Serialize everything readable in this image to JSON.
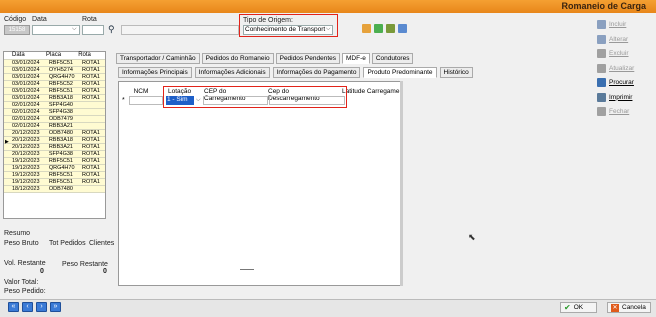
{
  "title": "Romaneio de Carga",
  "header": {
    "codigo_label": "Código",
    "codigo_value": "15158",
    "data_label": "Data",
    "rota_label": "Rota",
    "tipo_origem_label": "Tipo de Origem:",
    "tipo_origem_value": "Conhecimento de Transport"
  },
  "list": {
    "columns": [
      "Data",
      "Placa",
      "Rota"
    ],
    "rows": [
      [
        "03/01/2024",
        "RBF5C51",
        "ROTA1"
      ],
      [
        "03/01/2024",
        "OYH5274",
        "ROTA1"
      ],
      [
        "03/01/2024",
        "QRG4H70",
        "ROTA1"
      ],
      [
        "03/01/2024",
        "RBF5C52",
        "ROTA1"
      ],
      [
        "03/01/2024",
        "RBF5C51",
        "ROTA1"
      ],
      [
        "03/01/2024",
        "RBB3A18",
        "ROTA1"
      ],
      [
        "02/01/2024",
        "SFP4G40",
        ""
      ],
      [
        "02/01/2024",
        "SFP4G38",
        ""
      ],
      [
        "02/01/2024",
        "ODB7479",
        ""
      ],
      [
        "02/01/2024",
        "RBB3A21",
        ""
      ],
      [
        "20/12/2023",
        "ODB7480",
        "ROTA1"
      ],
      [
        "20/12/2023",
        "RBB3A18",
        "ROTA1"
      ],
      [
        "20/12/2023",
        "RBB3A21",
        "ROTA1"
      ],
      [
        "20/12/2023",
        "SFP4G38",
        "ROTA1"
      ],
      [
        "19/12/2023",
        "RBF5C51",
        "ROTA1"
      ],
      [
        "19/12/2023",
        "QRG4H70",
        "ROTA1"
      ],
      [
        "19/12/2023",
        "RBF5C51",
        "ROTA1"
      ],
      [
        "19/12/2023",
        "RBF5C51",
        "ROTA1"
      ],
      [
        "18/12/2023",
        "ODB7480",
        ""
      ]
    ]
  },
  "summary": {
    "resumo": "Resumo",
    "peso_bruto": "Peso Bruto",
    "tot_pedidos": "Tot Pedidos",
    "clientes": "Clientes",
    "vol_restante": "Vol. Restante",
    "vol_restante_value": "0",
    "peso_restante": "Peso Restante",
    "peso_restante_value": "0",
    "valor_total": "Valor Total:",
    "peso_pedido": "Peso Pedido:"
  },
  "tabs_row1": [
    "Transportador / Caminhão",
    "Pedidos do Romaneio",
    "Pedidos Pendentes",
    "MDF-e",
    "Condutores"
  ],
  "tabs_row2": [
    "Informações Principais",
    "Informações Adicionais",
    "Informações do Pagamento",
    "Produto Predominante",
    "Histórico"
  ],
  "grid": {
    "columns": [
      "NCM",
      "Lotação",
      "CEP do Carregamento",
      "Cep do Descarregamento",
      "Latitude Carregame"
    ],
    "row_marker": "*",
    "lotacao_value": "1 - Sim"
  },
  "side_buttons": [
    {
      "label": "Incluir",
      "enabled": false,
      "color": "#8aa0c0"
    },
    {
      "label": "Alterar",
      "enabled": false,
      "color": "#8aa0c0"
    },
    {
      "label": "Excluir",
      "enabled": false,
      "color": "#a0a0a0"
    },
    {
      "label": "Atualizar",
      "enabled": false,
      "color": "#a0a0a0"
    },
    {
      "label": "Procurar",
      "enabled": true,
      "color": "#3a6fb0"
    },
    {
      "label": "Imprimir",
      "enabled": true,
      "color": "#5a7a9a"
    },
    {
      "label": "Fechar",
      "enabled": false,
      "color": "#a0a0a0"
    }
  ],
  "footer": {
    "ok_label": "OK",
    "cancel_label": "Cancela",
    "nav": [
      "«",
      "‹",
      "›",
      "»"
    ]
  }
}
